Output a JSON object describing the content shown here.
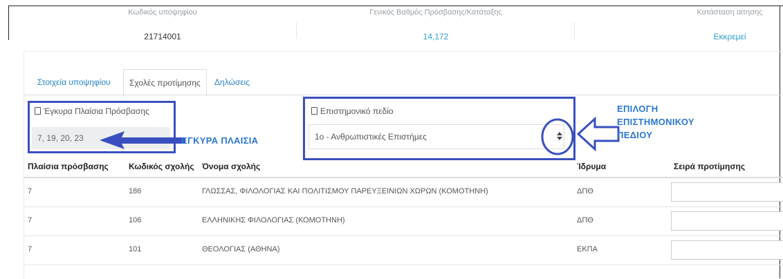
{
  "summary": {
    "candidate_code_label": "Κωδικός υποψηφίου",
    "candidate_code_value": "21714001",
    "grade_label": "Γενικός Βαθμός Πρόσβασης/Κατάταξης",
    "grade_value": "14,172",
    "status_label": "Κατάσταση αίτησης",
    "status_value": "Εκκρεμεί"
  },
  "tabs": [
    {
      "label": "Στοιχεία υποψηφίου"
    },
    {
      "label": "Σχολές προτίμησης"
    },
    {
      "label": "Δηλώσεις"
    }
  ],
  "valid_fields": {
    "label": "Έγκυρα Πλαίσια Πρόσβασης",
    "value": "7, 19, 20, 23"
  },
  "scientific_field": {
    "label": "Επιστημονικό πεδίο",
    "selected": "1ο - Ανθρωπιστικές Επιστήμες"
  },
  "annotations": {
    "valid_fields_note": "ΕΓΚΥΡΑ ΠΛΑΙΣΙΑ",
    "field_select_note_line1": "ΕΠΙΛΟΓΗ",
    "field_select_note_line2": "ΕΠΙΣΤΗΜΟΝΙΚΟΥ",
    "field_select_note_line3": "ΠΕΔΙΟΥ"
  },
  "colors": {
    "link": "#2a83c8",
    "annotation": "#3a4fbf"
  },
  "table": {
    "headers": [
      "Πλαίσια πρόσβασης",
      "Κωδικός σχολής",
      "Όνομα σχολής",
      "Ίδρυμα",
      "Σειρά προτίμησης"
    ],
    "rows": [
      {
        "frame": "7",
        "code": "186",
        "name": "ΓΛΩΣΣΑΣ, ΦΙΛΟΛΟΓΙΑΣ ΚΑΙ ΠΟΛΙΤΙΣΜΟΥ ΠΑΡΕΥΞΕΙΝΙΩΝ ΧΩΡΩΝ (ΚΟΜΟΤΗΝΗ)",
        "institution": "ΔΠΘ"
      },
      {
        "frame": "7",
        "code": "106",
        "name": "ΕΛΛΗΝΙΚΗΣ ΦΙΛΟΛΟΓΙΑΣ (ΚΟΜΟΤΗΝΗ)",
        "institution": "ΔΠΘ"
      },
      {
        "frame": "7",
        "code": "101",
        "name": "ΘΕΟΛΟΓΙΑΣ (ΑΘΗΝΑ)",
        "institution": "ΕΚΠΑ"
      }
    ]
  }
}
